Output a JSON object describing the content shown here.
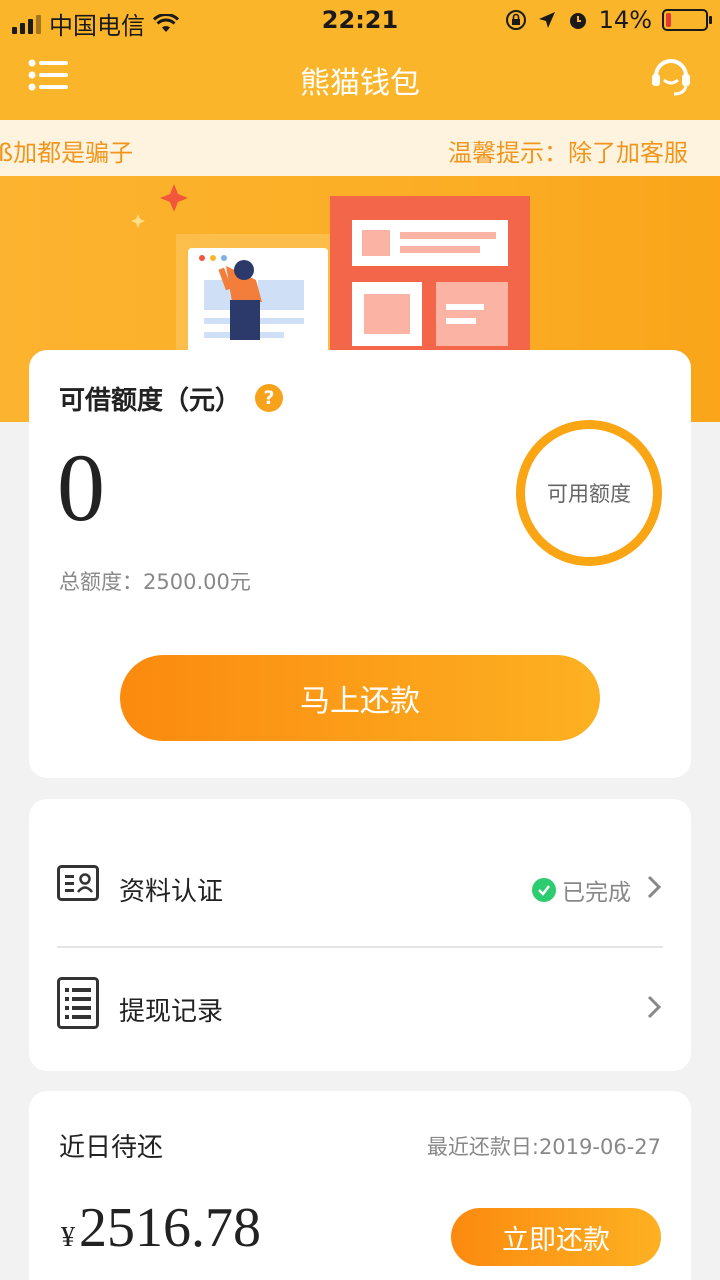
{
  "status_bar": {
    "carrier": "中国电信",
    "time": "22:21",
    "battery": "14%"
  },
  "nav": {
    "title": "熊猫钱包"
  },
  "marquee": {
    "text_left": "ß加都是骗子",
    "text_right": "温馨提示：除了加客服"
  },
  "quota_card": {
    "title": "可借额度（元）",
    "help": "?",
    "value": "0",
    "total_label": "总额度：2500.00元",
    "ring_label": "可用额度",
    "repay_button": "马上还款"
  },
  "menu": {
    "items": [
      {
        "label": "资料认证",
        "status": "已完成",
        "icon": "id-card-icon"
      },
      {
        "label": "提现记录",
        "status": "",
        "icon": "list-doc-icon"
      }
    ]
  },
  "due_card": {
    "title": "近日待还",
    "date": "最近还款日:2019-06-27",
    "currency": "¥",
    "amount": "2516.78",
    "button": "立即还款"
  },
  "colors": {
    "brand": "#fbb52a",
    "accent": "#fb8a0f",
    "success": "#2ecc71"
  }
}
